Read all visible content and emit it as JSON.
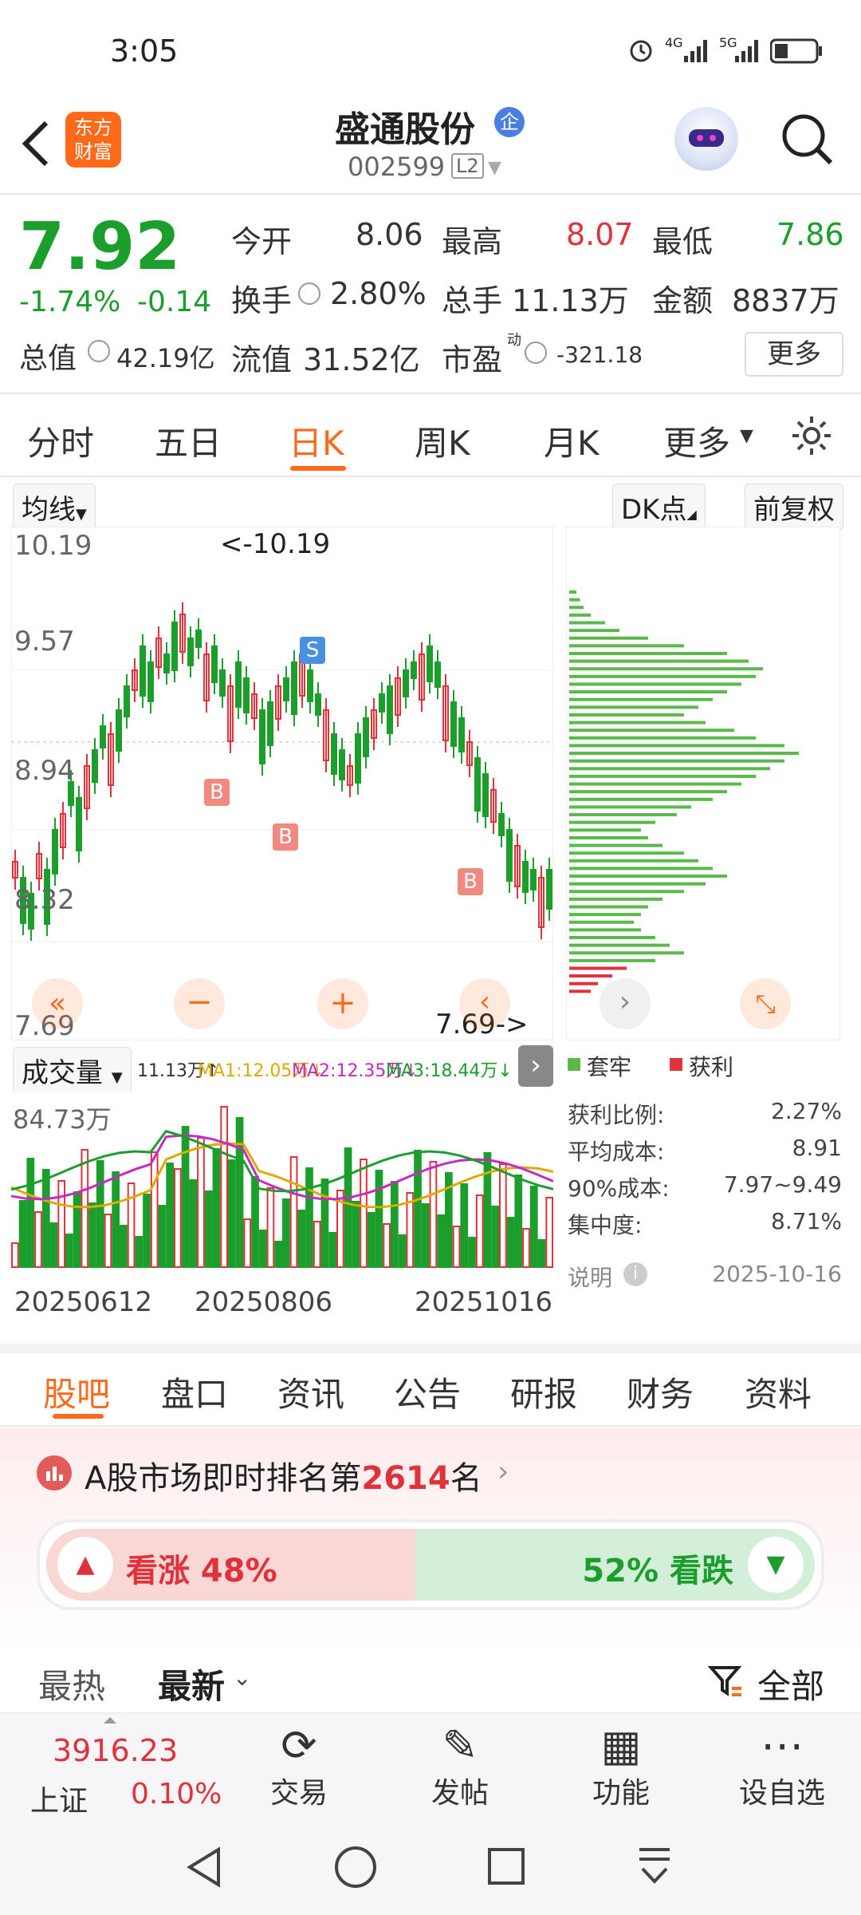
{
  "status": {
    "time": "3:05",
    "net1": "4G",
    "net2": "5G"
  },
  "header": {
    "badge_line1": "东方",
    "badge_line2": "财富",
    "stock_name": "盛通股份",
    "tag": "企",
    "code": "002599",
    "level": "L2"
  },
  "quote": {
    "price": "7.92",
    "change_pct": "-1.74%",
    "change": "-0.14",
    "open_label": "今开",
    "open": "8.06",
    "high_label": "最高",
    "high": "8.07",
    "low_label": "最低",
    "low": "7.86",
    "turnover_label": "换手",
    "turnover": "2.80%",
    "volume_label": "总手",
    "volume": "11.13万",
    "amount_label": "金额",
    "amount": "8837万",
    "mcap_label": "总值",
    "mcap": "42.19亿",
    "float_label": "流值",
    "float": "31.52亿",
    "pe_label": "市盈",
    "pe_sup": "动",
    "pe": "-321.18",
    "more": "更多"
  },
  "chart_tabs": [
    "分时",
    "五日",
    "日K",
    "周K",
    "月K",
    "更多"
  ],
  "chart_toolbar": {
    "ma_dropdown": "均线",
    "dk": "DK点",
    "adjust": "前复权"
  },
  "kline": {
    "y_labels": [
      "10.19",
      "9.57",
      "8.94",
      "8.32",
      "7.69"
    ],
    "max_note": "<-10.19",
    "min_note": "7.69->",
    "marker_s": "S",
    "marker_b": "B"
  },
  "chip_panel": {
    "legend_trapped": "套牢",
    "legend_profit": "获利",
    "rows": [
      {
        "label": "获利比例:",
        "value": "2.27%"
      },
      {
        "label": "平均成本:",
        "value": "8.91"
      },
      {
        "label": "90%成本:",
        "value": "7.97~9.49"
      },
      {
        "label": "集中度:",
        "value": "8.71%"
      }
    ],
    "note": "说明",
    "date": "2025-10-16"
  },
  "volume": {
    "dropdown": "成交量",
    "vol": "11.13万↑",
    "ma1": "MA1:12.05万↓",
    "ma2": "MA2:12.35万↓",
    "ma3": "MA3:18.44万↓",
    "max": "84.73万",
    "dates": [
      "20250612",
      "20250806",
      "20251016"
    ]
  },
  "info_tabs": [
    "股吧",
    "盘口",
    "资讯",
    "公告",
    "研报",
    "财务",
    "资料"
  ],
  "ranking": {
    "prefix": "A股市场即时排名第",
    "rank": "2614",
    "suffix": "名"
  },
  "sentiment": {
    "up_label": "看涨 48%",
    "down_label": "52% 看跌",
    "up_pct": 48
  },
  "feed": {
    "hot": "最热",
    "new": "最新",
    "filter": "全部"
  },
  "bottom_nav": {
    "index_value": "3916.23",
    "index_name": "上证",
    "index_change": "0.10%",
    "trade": "交易",
    "post": "发帖",
    "func": "功能",
    "watch": "设自选"
  },
  "colors": {
    "up": "#e0323a",
    "down": "#1c9e2c",
    "accent": "#ff6a1a"
  }
}
